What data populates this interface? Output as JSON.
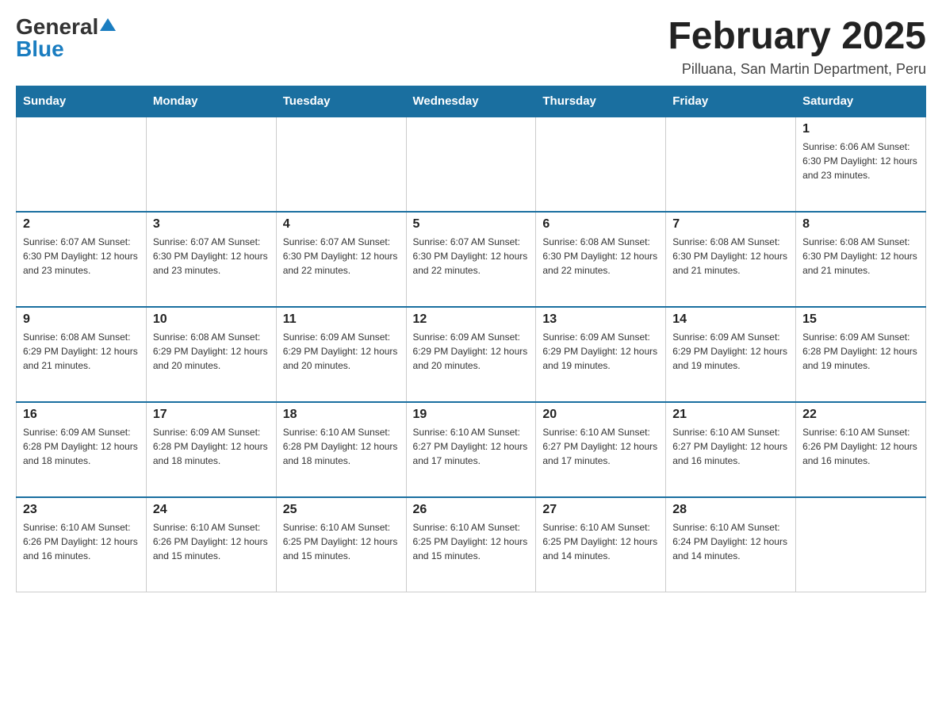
{
  "logo": {
    "general": "General",
    "blue": "Blue"
  },
  "title": "February 2025",
  "location": "Pilluana, San Martin Department, Peru",
  "days_header": [
    "Sunday",
    "Monday",
    "Tuesday",
    "Wednesday",
    "Thursday",
    "Friday",
    "Saturday"
  ],
  "weeks": [
    [
      {
        "day": "",
        "info": ""
      },
      {
        "day": "",
        "info": ""
      },
      {
        "day": "",
        "info": ""
      },
      {
        "day": "",
        "info": ""
      },
      {
        "day": "",
        "info": ""
      },
      {
        "day": "",
        "info": ""
      },
      {
        "day": "1",
        "info": "Sunrise: 6:06 AM\nSunset: 6:30 PM\nDaylight: 12 hours and 23 minutes."
      }
    ],
    [
      {
        "day": "2",
        "info": "Sunrise: 6:07 AM\nSunset: 6:30 PM\nDaylight: 12 hours and 23 minutes."
      },
      {
        "day": "3",
        "info": "Sunrise: 6:07 AM\nSunset: 6:30 PM\nDaylight: 12 hours and 23 minutes."
      },
      {
        "day": "4",
        "info": "Sunrise: 6:07 AM\nSunset: 6:30 PM\nDaylight: 12 hours and 22 minutes."
      },
      {
        "day": "5",
        "info": "Sunrise: 6:07 AM\nSunset: 6:30 PM\nDaylight: 12 hours and 22 minutes."
      },
      {
        "day": "6",
        "info": "Sunrise: 6:08 AM\nSunset: 6:30 PM\nDaylight: 12 hours and 22 minutes."
      },
      {
        "day": "7",
        "info": "Sunrise: 6:08 AM\nSunset: 6:30 PM\nDaylight: 12 hours and 21 minutes."
      },
      {
        "day": "8",
        "info": "Sunrise: 6:08 AM\nSunset: 6:30 PM\nDaylight: 12 hours and 21 minutes."
      }
    ],
    [
      {
        "day": "9",
        "info": "Sunrise: 6:08 AM\nSunset: 6:29 PM\nDaylight: 12 hours and 21 minutes."
      },
      {
        "day": "10",
        "info": "Sunrise: 6:08 AM\nSunset: 6:29 PM\nDaylight: 12 hours and 20 minutes."
      },
      {
        "day": "11",
        "info": "Sunrise: 6:09 AM\nSunset: 6:29 PM\nDaylight: 12 hours and 20 minutes."
      },
      {
        "day": "12",
        "info": "Sunrise: 6:09 AM\nSunset: 6:29 PM\nDaylight: 12 hours and 20 minutes."
      },
      {
        "day": "13",
        "info": "Sunrise: 6:09 AM\nSunset: 6:29 PM\nDaylight: 12 hours and 19 minutes."
      },
      {
        "day": "14",
        "info": "Sunrise: 6:09 AM\nSunset: 6:29 PM\nDaylight: 12 hours and 19 minutes."
      },
      {
        "day": "15",
        "info": "Sunrise: 6:09 AM\nSunset: 6:28 PM\nDaylight: 12 hours and 19 minutes."
      }
    ],
    [
      {
        "day": "16",
        "info": "Sunrise: 6:09 AM\nSunset: 6:28 PM\nDaylight: 12 hours and 18 minutes."
      },
      {
        "day": "17",
        "info": "Sunrise: 6:09 AM\nSunset: 6:28 PM\nDaylight: 12 hours and 18 minutes."
      },
      {
        "day": "18",
        "info": "Sunrise: 6:10 AM\nSunset: 6:28 PM\nDaylight: 12 hours and 18 minutes."
      },
      {
        "day": "19",
        "info": "Sunrise: 6:10 AM\nSunset: 6:27 PM\nDaylight: 12 hours and 17 minutes."
      },
      {
        "day": "20",
        "info": "Sunrise: 6:10 AM\nSunset: 6:27 PM\nDaylight: 12 hours and 17 minutes."
      },
      {
        "day": "21",
        "info": "Sunrise: 6:10 AM\nSunset: 6:27 PM\nDaylight: 12 hours and 16 minutes."
      },
      {
        "day": "22",
        "info": "Sunrise: 6:10 AM\nSunset: 6:26 PM\nDaylight: 12 hours and 16 minutes."
      }
    ],
    [
      {
        "day": "23",
        "info": "Sunrise: 6:10 AM\nSunset: 6:26 PM\nDaylight: 12 hours and 16 minutes."
      },
      {
        "day": "24",
        "info": "Sunrise: 6:10 AM\nSunset: 6:26 PM\nDaylight: 12 hours and 15 minutes."
      },
      {
        "day": "25",
        "info": "Sunrise: 6:10 AM\nSunset: 6:25 PM\nDaylight: 12 hours and 15 minutes."
      },
      {
        "day": "26",
        "info": "Sunrise: 6:10 AM\nSunset: 6:25 PM\nDaylight: 12 hours and 15 minutes."
      },
      {
        "day": "27",
        "info": "Sunrise: 6:10 AM\nSunset: 6:25 PM\nDaylight: 12 hours and 14 minutes."
      },
      {
        "day": "28",
        "info": "Sunrise: 6:10 AM\nSunset: 6:24 PM\nDaylight: 12 hours and 14 minutes."
      },
      {
        "day": "",
        "info": ""
      }
    ]
  ]
}
